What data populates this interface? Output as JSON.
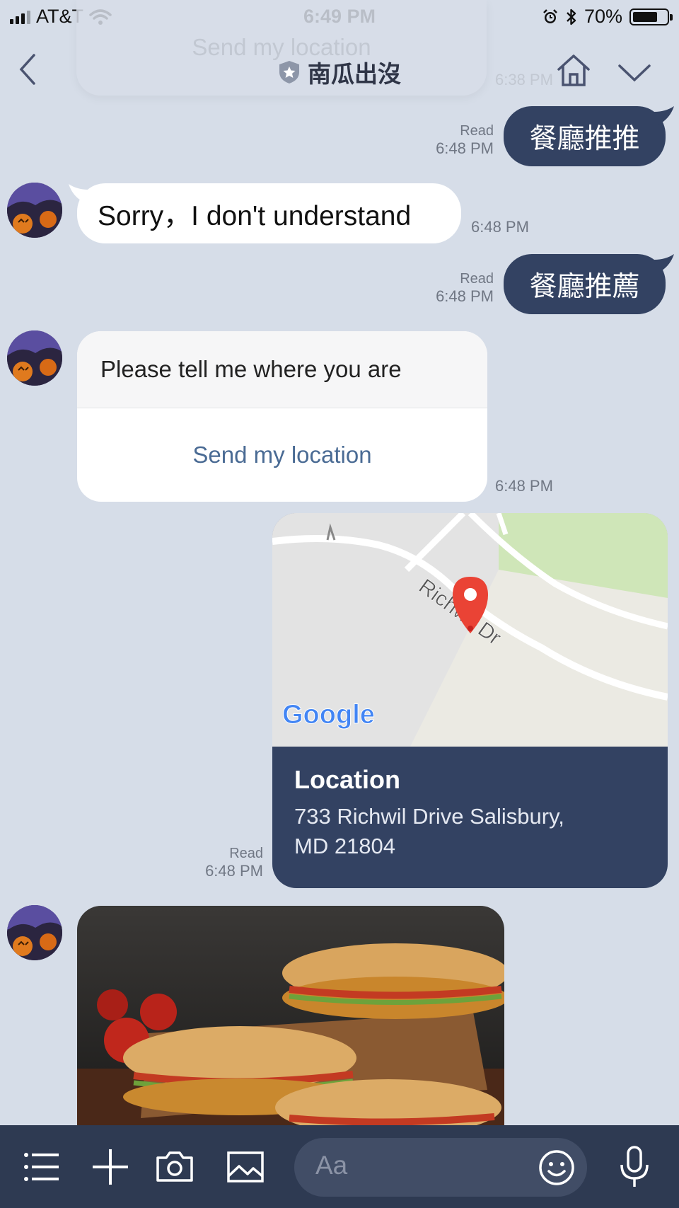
{
  "status_bar": {
    "carrier": "AT&T",
    "time": "6:49 PM",
    "battery": "70%",
    "battery_level": 0.7
  },
  "header": {
    "title": "南瓜出沒",
    "ghost_bubble_text": "Send my location",
    "ghost_time": "6:38 PM"
  },
  "messages": [
    {
      "from": "me",
      "text": "餐廳推推",
      "read": "Read",
      "time": "6:48 PM"
    },
    {
      "from": "bot",
      "text": "Sorry，I don't understand",
      "time": "6:48 PM"
    },
    {
      "from": "me",
      "text": "餐廳推薦",
      "read": "Read",
      "time": "6:48 PM"
    },
    {
      "from": "bot",
      "type": "template",
      "prompt": "Please tell me where you are",
      "action": "Send my location",
      "time": "6:48 PM"
    },
    {
      "from": "me",
      "type": "location",
      "map_street": "Richwil Dr",
      "map_logo": "Google",
      "label": "Location",
      "address_line1": "733 Richwil Drive Salisbury,",
      "address_line2": "MD 21804",
      "read": "Read",
      "time": "6:48 PM"
    },
    {
      "from": "bot",
      "type": "image",
      "description": "sandwich-photo"
    }
  ],
  "composer": {
    "placeholder": "Aa",
    "icons": [
      "menu-icon",
      "plus-icon",
      "camera-icon",
      "image-icon",
      "emoji-icon",
      "microphone-icon"
    ]
  },
  "colors": {
    "background": "#d6dde8",
    "my_bubble": "#334262",
    "bottom_bar": "#2e3a52",
    "link": "#4a6b94"
  }
}
